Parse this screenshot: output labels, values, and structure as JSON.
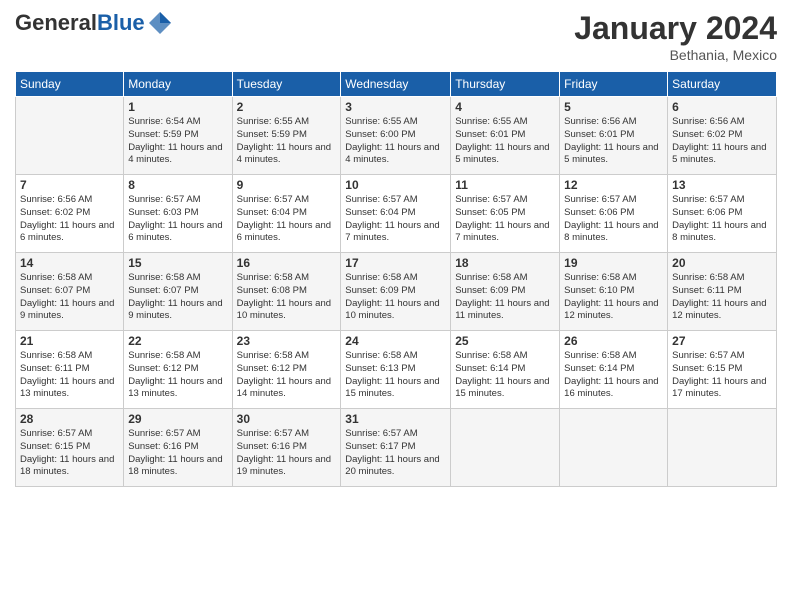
{
  "logo": {
    "general": "General",
    "blue": "Blue"
  },
  "header": {
    "month": "January 2024",
    "location": "Bethania, Mexico"
  },
  "weekdays": [
    "Sunday",
    "Monday",
    "Tuesday",
    "Wednesday",
    "Thursday",
    "Friday",
    "Saturday"
  ],
  "weeks": [
    [
      {
        "day": "",
        "sunrise": "",
        "sunset": "",
        "daylight": ""
      },
      {
        "day": "1",
        "sunrise": "Sunrise: 6:54 AM",
        "sunset": "Sunset: 5:59 PM",
        "daylight": "Daylight: 11 hours and 4 minutes."
      },
      {
        "day": "2",
        "sunrise": "Sunrise: 6:55 AM",
        "sunset": "Sunset: 5:59 PM",
        "daylight": "Daylight: 11 hours and 4 minutes."
      },
      {
        "day": "3",
        "sunrise": "Sunrise: 6:55 AM",
        "sunset": "Sunset: 6:00 PM",
        "daylight": "Daylight: 11 hours and 4 minutes."
      },
      {
        "day": "4",
        "sunrise": "Sunrise: 6:55 AM",
        "sunset": "Sunset: 6:01 PM",
        "daylight": "Daylight: 11 hours and 5 minutes."
      },
      {
        "day": "5",
        "sunrise": "Sunrise: 6:56 AM",
        "sunset": "Sunset: 6:01 PM",
        "daylight": "Daylight: 11 hours and 5 minutes."
      },
      {
        "day": "6",
        "sunrise": "Sunrise: 6:56 AM",
        "sunset": "Sunset: 6:02 PM",
        "daylight": "Daylight: 11 hours and 5 minutes."
      }
    ],
    [
      {
        "day": "7",
        "sunrise": "Sunrise: 6:56 AM",
        "sunset": "Sunset: 6:02 PM",
        "daylight": "Daylight: 11 hours and 6 minutes."
      },
      {
        "day": "8",
        "sunrise": "Sunrise: 6:57 AM",
        "sunset": "Sunset: 6:03 PM",
        "daylight": "Daylight: 11 hours and 6 minutes."
      },
      {
        "day": "9",
        "sunrise": "Sunrise: 6:57 AM",
        "sunset": "Sunset: 6:04 PM",
        "daylight": "Daylight: 11 hours and 6 minutes."
      },
      {
        "day": "10",
        "sunrise": "Sunrise: 6:57 AM",
        "sunset": "Sunset: 6:04 PM",
        "daylight": "Daylight: 11 hours and 7 minutes."
      },
      {
        "day": "11",
        "sunrise": "Sunrise: 6:57 AM",
        "sunset": "Sunset: 6:05 PM",
        "daylight": "Daylight: 11 hours and 7 minutes."
      },
      {
        "day": "12",
        "sunrise": "Sunrise: 6:57 AM",
        "sunset": "Sunset: 6:06 PM",
        "daylight": "Daylight: 11 hours and 8 minutes."
      },
      {
        "day": "13",
        "sunrise": "Sunrise: 6:57 AM",
        "sunset": "Sunset: 6:06 PM",
        "daylight": "Daylight: 11 hours and 8 minutes."
      }
    ],
    [
      {
        "day": "14",
        "sunrise": "Sunrise: 6:58 AM",
        "sunset": "Sunset: 6:07 PM",
        "daylight": "Daylight: 11 hours and 9 minutes."
      },
      {
        "day": "15",
        "sunrise": "Sunrise: 6:58 AM",
        "sunset": "Sunset: 6:07 PM",
        "daylight": "Daylight: 11 hours and 9 minutes."
      },
      {
        "day": "16",
        "sunrise": "Sunrise: 6:58 AM",
        "sunset": "Sunset: 6:08 PM",
        "daylight": "Daylight: 11 hours and 10 minutes."
      },
      {
        "day": "17",
        "sunrise": "Sunrise: 6:58 AM",
        "sunset": "Sunset: 6:09 PM",
        "daylight": "Daylight: 11 hours and 10 minutes."
      },
      {
        "day": "18",
        "sunrise": "Sunrise: 6:58 AM",
        "sunset": "Sunset: 6:09 PM",
        "daylight": "Daylight: 11 hours and 11 minutes."
      },
      {
        "day": "19",
        "sunrise": "Sunrise: 6:58 AM",
        "sunset": "Sunset: 6:10 PM",
        "daylight": "Daylight: 11 hours and 12 minutes."
      },
      {
        "day": "20",
        "sunrise": "Sunrise: 6:58 AM",
        "sunset": "Sunset: 6:11 PM",
        "daylight": "Daylight: 11 hours and 12 minutes."
      }
    ],
    [
      {
        "day": "21",
        "sunrise": "Sunrise: 6:58 AM",
        "sunset": "Sunset: 6:11 PM",
        "daylight": "Daylight: 11 hours and 13 minutes."
      },
      {
        "day": "22",
        "sunrise": "Sunrise: 6:58 AM",
        "sunset": "Sunset: 6:12 PM",
        "daylight": "Daylight: 11 hours and 13 minutes."
      },
      {
        "day": "23",
        "sunrise": "Sunrise: 6:58 AM",
        "sunset": "Sunset: 6:12 PM",
        "daylight": "Daylight: 11 hours and 14 minutes."
      },
      {
        "day": "24",
        "sunrise": "Sunrise: 6:58 AM",
        "sunset": "Sunset: 6:13 PM",
        "daylight": "Daylight: 11 hours and 15 minutes."
      },
      {
        "day": "25",
        "sunrise": "Sunrise: 6:58 AM",
        "sunset": "Sunset: 6:14 PM",
        "daylight": "Daylight: 11 hours and 15 minutes."
      },
      {
        "day": "26",
        "sunrise": "Sunrise: 6:58 AM",
        "sunset": "Sunset: 6:14 PM",
        "daylight": "Daylight: 11 hours and 16 minutes."
      },
      {
        "day": "27",
        "sunrise": "Sunrise: 6:57 AM",
        "sunset": "Sunset: 6:15 PM",
        "daylight": "Daylight: 11 hours and 17 minutes."
      }
    ],
    [
      {
        "day": "28",
        "sunrise": "Sunrise: 6:57 AM",
        "sunset": "Sunset: 6:15 PM",
        "daylight": "Daylight: 11 hours and 18 minutes."
      },
      {
        "day": "29",
        "sunrise": "Sunrise: 6:57 AM",
        "sunset": "Sunset: 6:16 PM",
        "daylight": "Daylight: 11 hours and 18 minutes."
      },
      {
        "day": "30",
        "sunrise": "Sunrise: 6:57 AM",
        "sunset": "Sunset: 6:16 PM",
        "daylight": "Daylight: 11 hours and 19 minutes."
      },
      {
        "day": "31",
        "sunrise": "Sunrise: 6:57 AM",
        "sunset": "Sunset: 6:17 PM",
        "daylight": "Daylight: 11 hours and 20 minutes."
      },
      {
        "day": "",
        "sunrise": "",
        "sunset": "",
        "daylight": ""
      },
      {
        "day": "",
        "sunrise": "",
        "sunset": "",
        "daylight": ""
      },
      {
        "day": "",
        "sunrise": "",
        "sunset": "",
        "daylight": ""
      }
    ]
  ]
}
